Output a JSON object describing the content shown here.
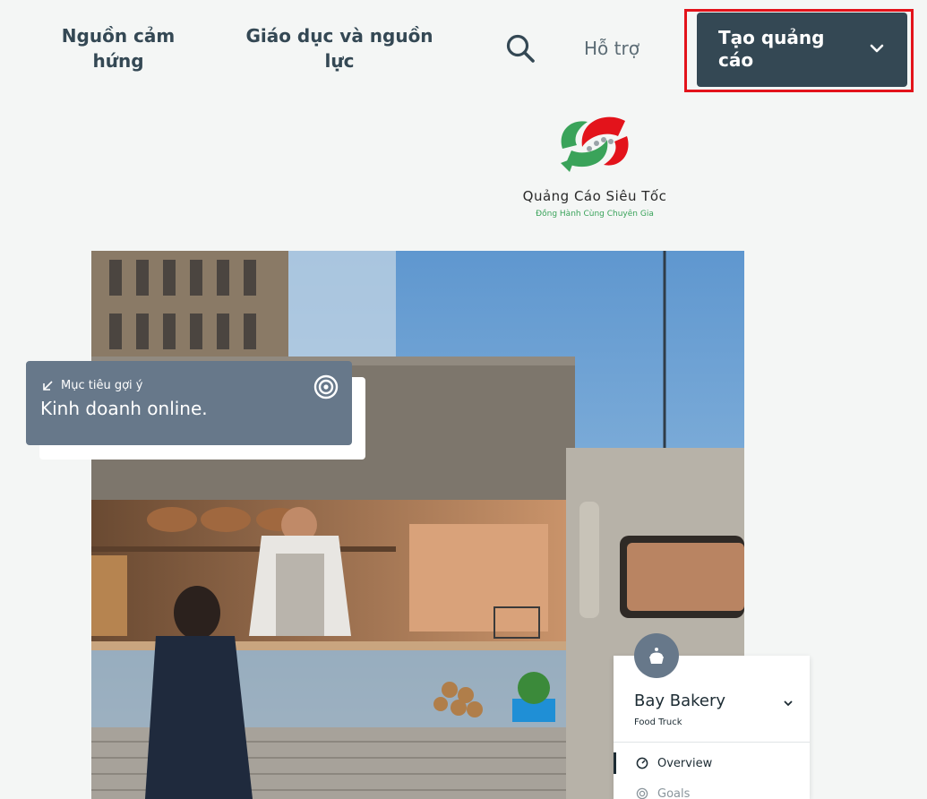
{
  "nav": {
    "inspiration": "Nguồn cảm hứng",
    "education": "Giáo dục và nguồn lực",
    "support": "Hỗ trợ",
    "cta": "Tạo quảng cáo"
  },
  "logo": {
    "title": "Quảng Cáo Siêu Tốc",
    "subtitle": "Đồng Hành Cùng Chuyên Gia"
  },
  "goal_card": {
    "label": "Mục tiêu gợi ý",
    "value": "Kinh doanh online."
  },
  "business_panel": {
    "name": "Bay Bakery",
    "type": "Food Truck",
    "menu": [
      {
        "label": "Overview"
      },
      {
        "label": "Goals"
      }
    ]
  },
  "colors": {
    "background": "#f4f6f5",
    "primary_dark": "#344854",
    "highlight_red": "#e3131b",
    "card_slate": "#67788a",
    "logo_green": "#3aa35a",
    "logo_red": "#e3131b"
  },
  "icons": {
    "search": "search-icon",
    "cta_chevron": "chevron-down-icon",
    "goal_arrow": "arrow-down-left-icon",
    "goal_target": "target-icon",
    "avatar": "cake-icon",
    "overview": "gauge-icon",
    "goals": "target-icon"
  }
}
